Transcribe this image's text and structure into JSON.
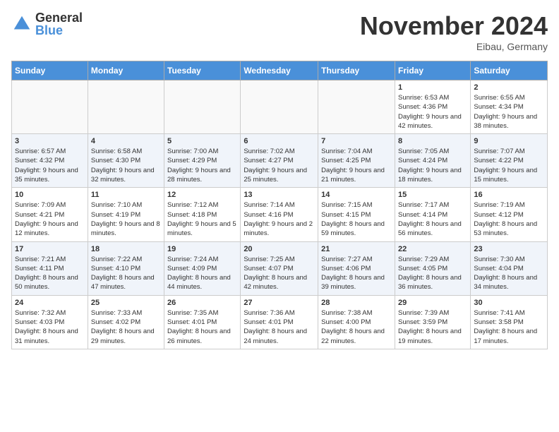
{
  "header": {
    "logo_general": "General",
    "logo_blue": "Blue",
    "month_title": "November 2024",
    "location": "Eibau, Germany"
  },
  "weekdays": [
    "Sunday",
    "Monday",
    "Tuesday",
    "Wednesday",
    "Thursday",
    "Friday",
    "Saturday"
  ],
  "weeks": [
    [
      {
        "day": "",
        "info": ""
      },
      {
        "day": "",
        "info": ""
      },
      {
        "day": "",
        "info": ""
      },
      {
        "day": "",
        "info": ""
      },
      {
        "day": "",
        "info": ""
      },
      {
        "day": "1",
        "info": "Sunrise: 6:53 AM\nSunset: 4:36 PM\nDaylight: 9 hours and 42 minutes."
      },
      {
        "day": "2",
        "info": "Sunrise: 6:55 AM\nSunset: 4:34 PM\nDaylight: 9 hours and 38 minutes."
      }
    ],
    [
      {
        "day": "3",
        "info": "Sunrise: 6:57 AM\nSunset: 4:32 PM\nDaylight: 9 hours and 35 minutes."
      },
      {
        "day": "4",
        "info": "Sunrise: 6:58 AM\nSunset: 4:30 PM\nDaylight: 9 hours and 32 minutes."
      },
      {
        "day": "5",
        "info": "Sunrise: 7:00 AM\nSunset: 4:29 PM\nDaylight: 9 hours and 28 minutes."
      },
      {
        "day": "6",
        "info": "Sunrise: 7:02 AM\nSunset: 4:27 PM\nDaylight: 9 hours and 25 minutes."
      },
      {
        "day": "7",
        "info": "Sunrise: 7:04 AM\nSunset: 4:25 PM\nDaylight: 9 hours and 21 minutes."
      },
      {
        "day": "8",
        "info": "Sunrise: 7:05 AM\nSunset: 4:24 PM\nDaylight: 9 hours and 18 minutes."
      },
      {
        "day": "9",
        "info": "Sunrise: 7:07 AM\nSunset: 4:22 PM\nDaylight: 9 hours and 15 minutes."
      }
    ],
    [
      {
        "day": "10",
        "info": "Sunrise: 7:09 AM\nSunset: 4:21 PM\nDaylight: 9 hours and 12 minutes."
      },
      {
        "day": "11",
        "info": "Sunrise: 7:10 AM\nSunset: 4:19 PM\nDaylight: 9 hours and 8 minutes."
      },
      {
        "day": "12",
        "info": "Sunrise: 7:12 AM\nSunset: 4:18 PM\nDaylight: 9 hours and 5 minutes."
      },
      {
        "day": "13",
        "info": "Sunrise: 7:14 AM\nSunset: 4:16 PM\nDaylight: 9 hours and 2 minutes."
      },
      {
        "day": "14",
        "info": "Sunrise: 7:15 AM\nSunset: 4:15 PM\nDaylight: 8 hours and 59 minutes."
      },
      {
        "day": "15",
        "info": "Sunrise: 7:17 AM\nSunset: 4:14 PM\nDaylight: 8 hours and 56 minutes."
      },
      {
        "day": "16",
        "info": "Sunrise: 7:19 AM\nSunset: 4:12 PM\nDaylight: 8 hours and 53 minutes."
      }
    ],
    [
      {
        "day": "17",
        "info": "Sunrise: 7:21 AM\nSunset: 4:11 PM\nDaylight: 8 hours and 50 minutes."
      },
      {
        "day": "18",
        "info": "Sunrise: 7:22 AM\nSunset: 4:10 PM\nDaylight: 8 hours and 47 minutes."
      },
      {
        "day": "19",
        "info": "Sunrise: 7:24 AM\nSunset: 4:09 PM\nDaylight: 8 hours and 44 minutes."
      },
      {
        "day": "20",
        "info": "Sunrise: 7:25 AM\nSunset: 4:07 PM\nDaylight: 8 hours and 42 minutes."
      },
      {
        "day": "21",
        "info": "Sunrise: 7:27 AM\nSunset: 4:06 PM\nDaylight: 8 hours and 39 minutes."
      },
      {
        "day": "22",
        "info": "Sunrise: 7:29 AM\nSunset: 4:05 PM\nDaylight: 8 hours and 36 minutes."
      },
      {
        "day": "23",
        "info": "Sunrise: 7:30 AM\nSunset: 4:04 PM\nDaylight: 8 hours and 34 minutes."
      }
    ],
    [
      {
        "day": "24",
        "info": "Sunrise: 7:32 AM\nSunset: 4:03 PM\nDaylight: 8 hours and 31 minutes."
      },
      {
        "day": "25",
        "info": "Sunrise: 7:33 AM\nSunset: 4:02 PM\nDaylight: 8 hours and 29 minutes."
      },
      {
        "day": "26",
        "info": "Sunrise: 7:35 AM\nSunset: 4:01 PM\nDaylight: 8 hours and 26 minutes."
      },
      {
        "day": "27",
        "info": "Sunrise: 7:36 AM\nSunset: 4:01 PM\nDaylight: 8 hours and 24 minutes."
      },
      {
        "day": "28",
        "info": "Sunrise: 7:38 AM\nSunset: 4:00 PM\nDaylight: 8 hours and 22 minutes."
      },
      {
        "day": "29",
        "info": "Sunrise: 7:39 AM\nSunset: 3:59 PM\nDaylight: 8 hours and 19 minutes."
      },
      {
        "day": "30",
        "info": "Sunrise: 7:41 AM\nSunset: 3:58 PM\nDaylight: 8 hours and 17 minutes."
      }
    ]
  ]
}
